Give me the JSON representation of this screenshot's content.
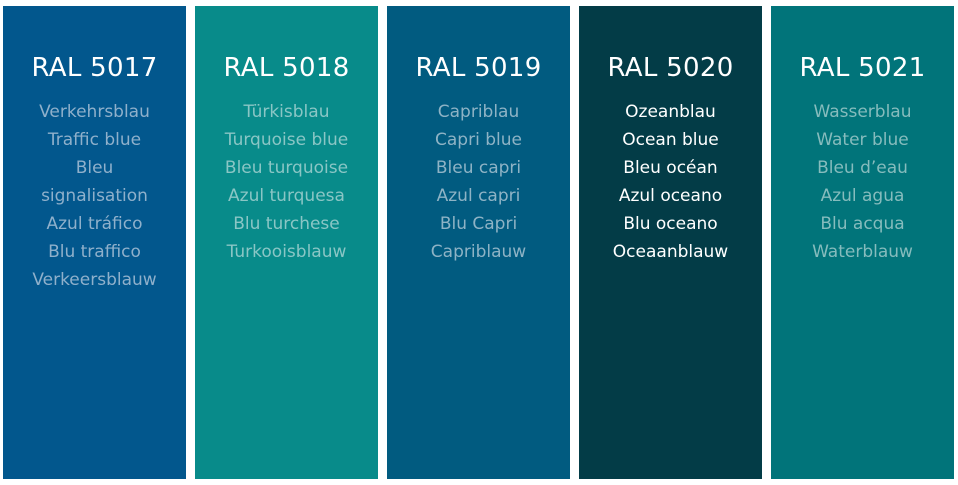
{
  "swatches": [
    {
      "code": "RAL 5017",
      "color": "#02578d",
      "text_color": "#8fb0cb",
      "names": [
        "Verkehrsblau",
        "Traffic blue",
        "Bleu signalisation",
        "Azul tráfico",
        "Blu traffico",
        "Verkeersblauw"
      ]
    },
    {
      "code": "RAL 5018",
      "color": "#088b8a",
      "text_color": "#8ac6c5",
      "names": [
        "Türkisblau",
        "Turquoise blue",
        "Bleu turquoise",
        "Azul turquesa",
        "Blu turchese",
        "Turkooisblauw"
      ]
    },
    {
      "code": "RAL 5019",
      "color": "#015b80",
      "text_color": "#8eb3c5",
      "names": [
        "Capriblau",
        "Capri blue",
        "Bleu capri",
        "Azul capri",
        "Blu Capri",
        "Capriblauw"
      ]
    },
    {
      "code": "RAL 5020",
      "color": "#033c47",
      "text_color": "#ffffff",
      "names": [
        "Ozeanblau",
        "Ocean blue",
        "Bleu océan",
        "Azul oceano",
        "Blu oceano",
        "Oceaanblauw"
      ]
    },
    {
      "code": "RAL 5021",
      "color": "#01747a",
      "text_color": "#86bcbd",
      "names": [
        "Wasserblau",
        "Water blue",
        "Bleu d’eau",
        "Azul agua",
        "Blu acqua",
        "Waterblauw"
      ]
    }
  ]
}
